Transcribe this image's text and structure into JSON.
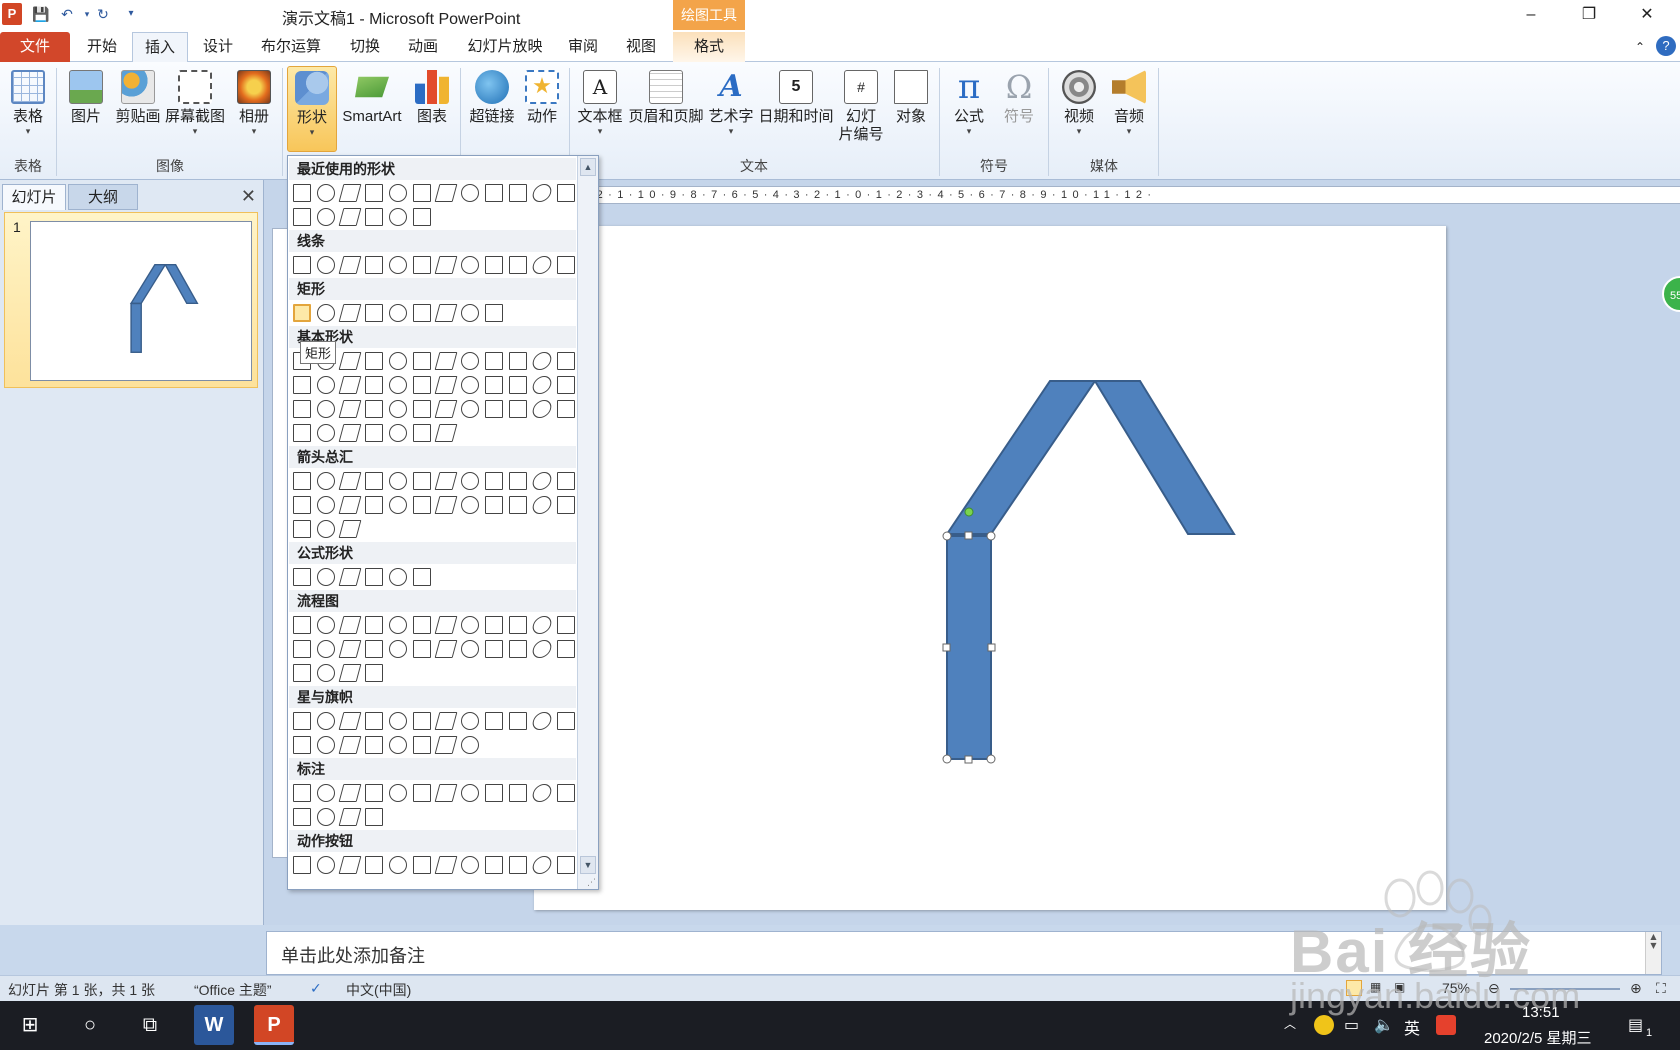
{
  "titlebar": {
    "app_logo": "P",
    "title": "演示文稿1 - Microsoft PowerPoint",
    "drawing_tools": "绘图工具",
    "minimize": "–",
    "restore": "❐",
    "close": "✕",
    "quick_access": {
      "save_icon": "save-icon",
      "undo_icon": "undo-icon",
      "redo_icon": "redo-icon",
      "customize_icon": "customize-icon"
    }
  },
  "tabs": {
    "file": "文件",
    "home": "开始",
    "insert": "插入",
    "design": "设计",
    "boolean": "布尔运算",
    "transitions": "切换",
    "animations": "动画",
    "slideshow": "幻灯片放映",
    "review": "审阅",
    "view": "视图",
    "format": "格式",
    "collapse": "⌃",
    "help": "?"
  },
  "ribbon": {
    "table": "表格",
    "picture": "图片",
    "clipart": "剪贴画",
    "screenshot": "屏幕截图",
    "album": "相册",
    "shapes": "形状",
    "smartart": "SmartArt",
    "chart": "图表",
    "hyperlink": "超链接",
    "action": "动作",
    "textbox": "文本框",
    "header_footer": "页眉和页脚",
    "wordart": "艺术字",
    "datetime": "日期和时间",
    "slide_number_1": "幻灯",
    "slide_number_2": "片编号",
    "object": "对象",
    "equation": "公式",
    "symbol": "符号",
    "video": "视频",
    "audio": "音频",
    "groups": {
      "tables": "表格",
      "images": "图像",
      "text": "文本",
      "symbols": "符号",
      "media": "媒体"
    }
  },
  "left_pane": {
    "tab_slides": "幻灯片",
    "tab_outline": "大纲",
    "close": "✕",
    "slide_number": "1"
  },
  "ruler": {
    "h_ticks": "·3·2·1·10·9·8·7·6·5·4·3·2·1·0·1·2·3·4·5·6·7·8·9·10·11·12·"
  },
  "notes": {
    "placeholder": "单击此处添加备注"
  },
  "side_bubble": "55",
  "statusbar": {
    "slide_info": "幻灯片 第 1 张，共 1 张",
    "theme": "“Office 主题”",
    "language": "中文(中国)",
    "zoom": "75%"
  },
  "taskbar": {
    "time": "13:51",
    "date": "2020/2/5 星期三",
    "ime": "英",
    "notification_count": "1"
  },
  "gallery": {
    "categories": {
      "recent": "最近使用的形状",
      "lines": "线条",
      "rectangles": "矩形",
      "basic": "基本形状",
      "arrows": "箭头总汇",
      "equation": "公式形状",
      "flowchart": "流程图",
      "stars": "星与旗帜",
      "callouts": "标注",
      "action_buttons": "动作按钮"
    },
    "tooltip": "矩形"
  },
  "watermark": {
    "brand": "Bai 经验",
    "url": "jingyan.baidu.com"
  },
  "colors": {
    "shape_fill": "#4f81bd",
    "shape_stroke": "#385d8a",
    "file_tab": "#d2472a",
    "drawing_tools": "#f3a44a"
  }
}
